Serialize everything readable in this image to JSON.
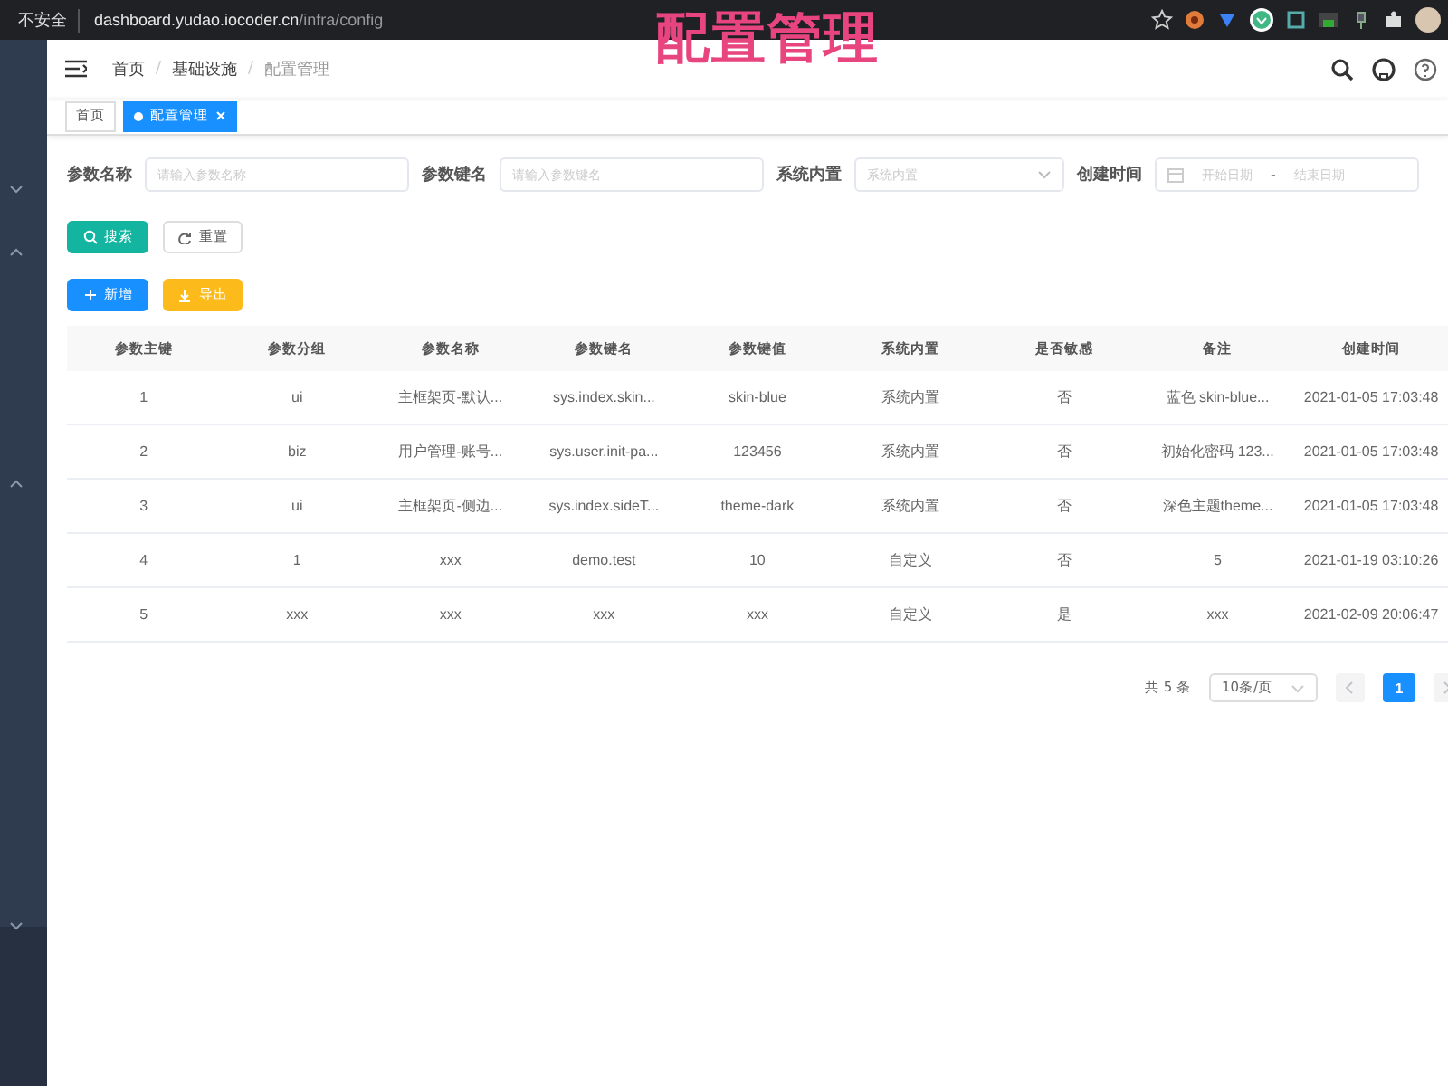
{
  "browser": {
    "security": "不安全",
    "url_host": "dashboard.yudao.iocoder.cn",
    "url_path": "/infra/config"
  },
  "caption": "配置管理",
  "breadcrumb": {
    "separator": "/",
    "items": [
      {
        "label": "首页"
      },
      {
        "label": "基础设施"
      },
      {
        "label": "配置管理"
      }
    ]
  },
  "tags": [
    {
      "label": "首页",
      "selected": false
    },
    {
      "label": "配置管理",
      "selected": true
    }
  ],
  "filters": [
    {
      "label": "参数名称",
      "kind": "input",
      "placeholder": "请输入参数名称"
    },
    {
      "label": "参数键名",
      "kind": "input",
      "placeholder": "请输入参数键名"
    },
    {
      "label": "系统内置",
      "kind": "select",
      "placeholder": "系统内置"
    },
    {
      "label": "创建时间",
      "kind": "daterange",
      "start_placeholder": "开始日期",
      "separator": "-",
      "end_placeholder": "结束日期"
    }
  ],
  "search_buttons": [
    {
      "label": "搜索",
      "kind": "primary"
    },
    {
      "label": "重置",
      "kind": "plain"
    }
  ],
  "action_buttons": [
    {
      "label": "新增",
      "kind": "add"
    },
    {
      "label": "导出",
      "kind": "export"
    }
  ],
  "table": {
    "columns": [
      "参数主键",
      "参数分组",
      "参数名称",
      "参数键名",
      "参数键值",
      "系统内置",
      "是否敏感",
      "备注",
      "创建时间"
    ],
    "rows": [
      [
        "1",
        "ui",
        "主框架页-默认...",
        "sys.index.skin...",
        "skin-blue",
        "系统内置",
        "否",
        "蓝色 skin-blue...",
        "2021-01-05 17:03:48"
      ],
      [
        "2",
        "biz",
        "用户管理-账号...",
        "sys.user.init-pa...",
        "123456",
        "系统内置",
        "否",
        "初始化密码 123...",
        "2021-01-05 17:03:48"
      ],
      [
        "3",
        "ui",
        "主框架页-侧边...",
        "sys.index.sideT...",
        "theme-dark",
        "系统内置",
        "否",
        "深色主题theme...",
        "2021-01-05 17:03:48"
      ],
      [
        "4",
        "1",
        "xxx",
        "demo.test",
        "10",
        "自定义",
        "否",
        "5",
        "2021-01-19 03:10:26"
      ],
      [
        "5",
        "xxx",
        "xxx",
        "xxx",
        "xxx",
        "自定义",
        "是",
        "xxx",
        "2021-02-09 20:06:47"
      ]
    ]
  },
  "pagination": {
    "total": "共 5 条",
    "page_size": "10条/页",
    "pages": [
      {
        "label": "1",
        "selected": true
      }
    ]
  }
}
